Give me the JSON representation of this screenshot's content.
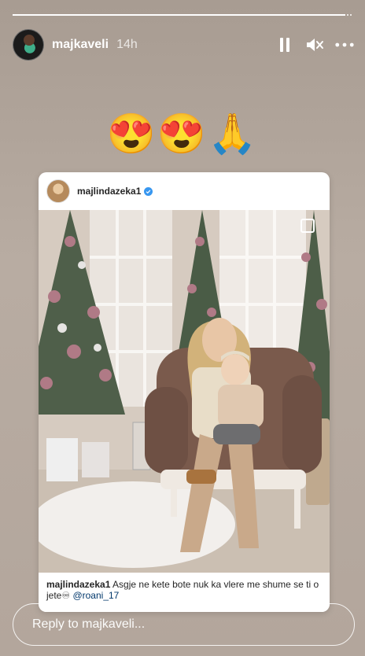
{
  "story": {
    "progress_fraction": 0.98
  },
  "header": {
    "username": "majkaveli",
    "time": "14h",
    "avatar_icon": "profile-avatar"
  },
  "emojis": "😍😍🙏",
  "post": {
    "username": "majlindazeka1",
    "verified": true,
    "caption_user": "majlindazeka1",
    "caption_text": "Asgje ne kete bote nuk ka vlere me shume se ti o jete♾",
    "caption_mention": "@roani_17"
  },
  "reply": {
    "placeholder": "Reply to majkaveli..."
  },
  "colors": {
    "background": "#b3a69c",
    "verified_blue": "#3897f0",
    "mention": "#00376b"
  }
}
